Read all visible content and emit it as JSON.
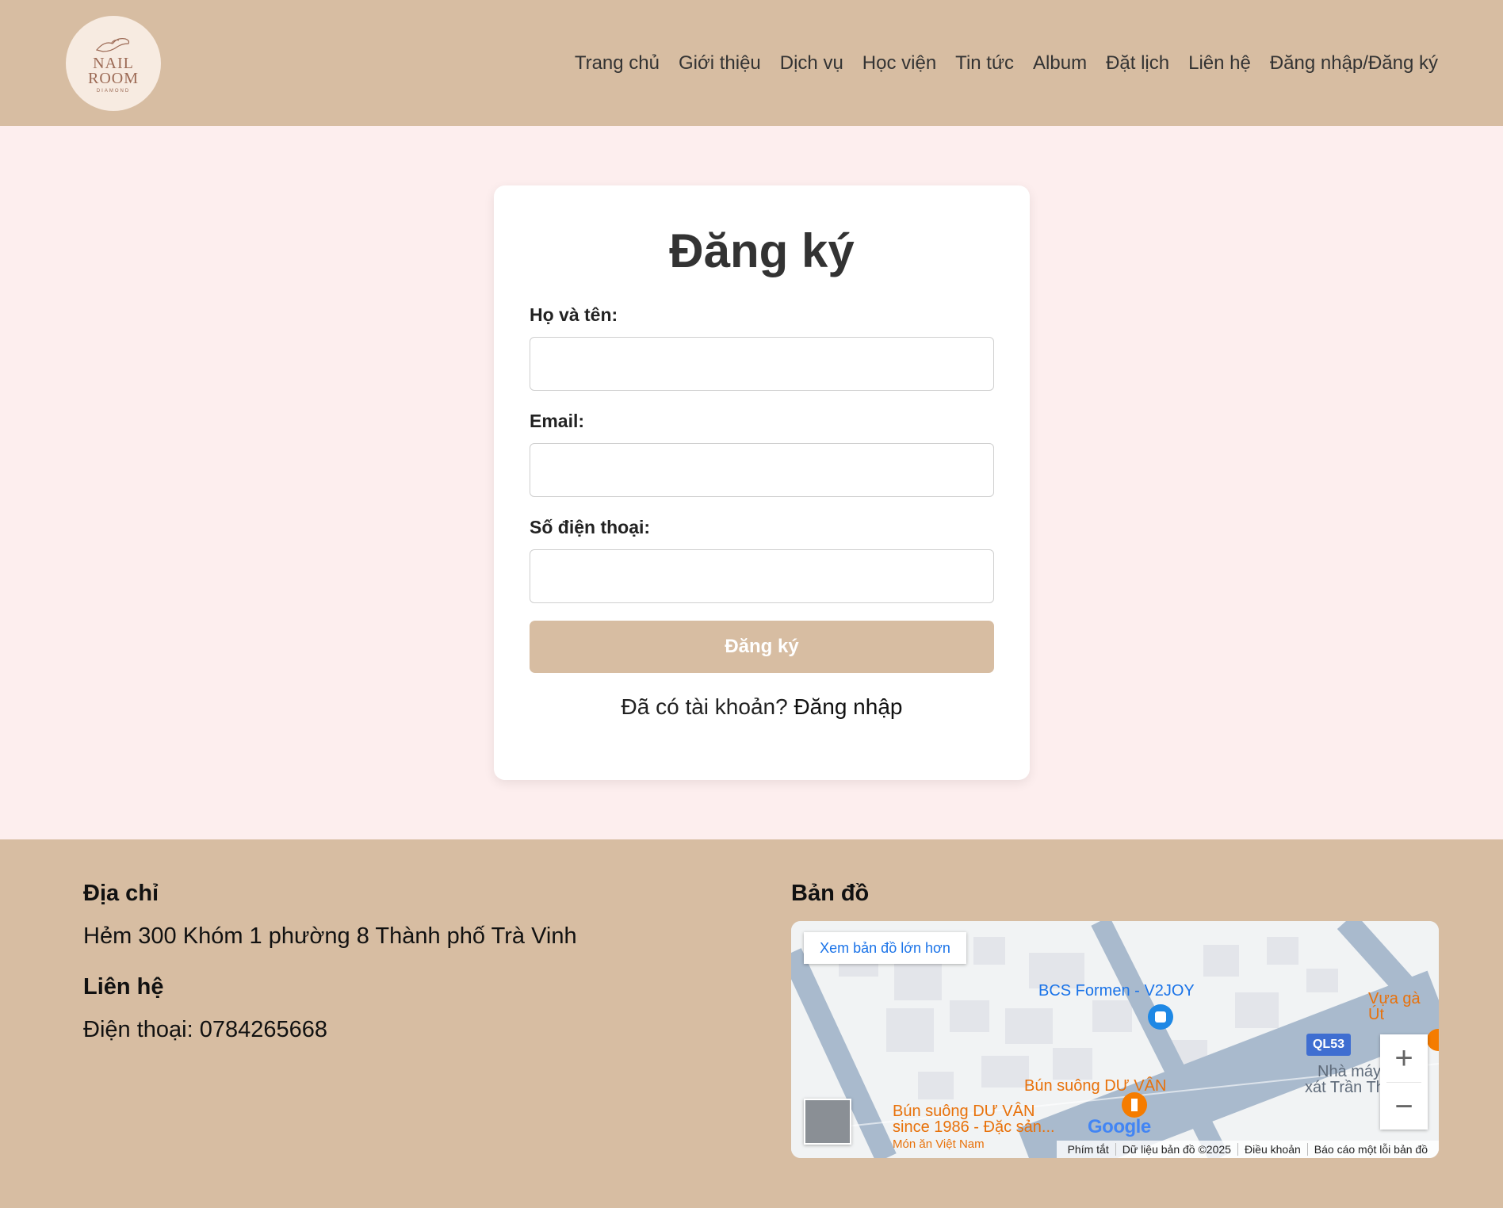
{
  "header": {
    "logo": {
      "line1": "NAIL",
      "line2": "ROOM",
      "line3": "DIAMOND"
    },
    "nav": [
      "Trang chủ",
      "Giới thiệu",
      "Dịch vụ",
      "Học viện",
      "Tin tức",
      "Album",
      "Đặt lịch",
      "Liên hệ",
      "Đăng nhập/Đăng ký"
    ]
  },
  "form": {
    "title": "Đăng ký",
    "fields": [
      {
        "label": "Họ và tên:",
        "value": ""
      },
      {
        "label": "Email:",
        "value": ""
      },
      {
        "label": "Số điện thoại:",
        "value": ""
      }
    ],
    "submit_label": "Đăng ký",
    "login_prompt": "Đã có tài khoản?",
    "login_link": "Đăng nhập"
  },
  "footer": {
    "address_heading": "Địa chỉ",
    "address": "Hẻm 300 Khóm 1 phường 8 Thành phố Trà Vinh",
    "contact_heading": "Liên hệ",
    "phone": "Điện thoại: 0784265668",
    "map_heading": "Bản đồ",
    "map": {
      "larger_map_link": "Xem bản đồ lớn hơn",
      "places": {
        "bcs": "BCS Formen - V2JOY",
        "vua_ga": "Vựa gà Út",
        "bun_suong_1": "Bún suông DƯ VÂN",
        "bun_suong_2_line1": "Bún suông DƯ VÂN",
        "bun_suong_2_line2": "since 1986 - Đặc sản...",
        "bun_suong_2_line3": "Món ăn Việt Nam",
        "nha_may_line1": "Nhà máy",
        "nha_may_line2": "xát Trần Th"
      },
      "road_badge": "QL53",
      "google": "Google",
      "zoom_in": "+",
      "zoom_out": "−",
      "attribution": [
        "Phím tắt",
        "Dữ liệu bản đồ ©2025",
        "Điều khoản",
        "Báo cáo một lỗi bản đồ"
      ]
    }
  },
  "colors": {
    "header_bg": "#d7bda2",
    "page_bg": "#fdeeee",
    "button": "#d7bda2"
  }
}
